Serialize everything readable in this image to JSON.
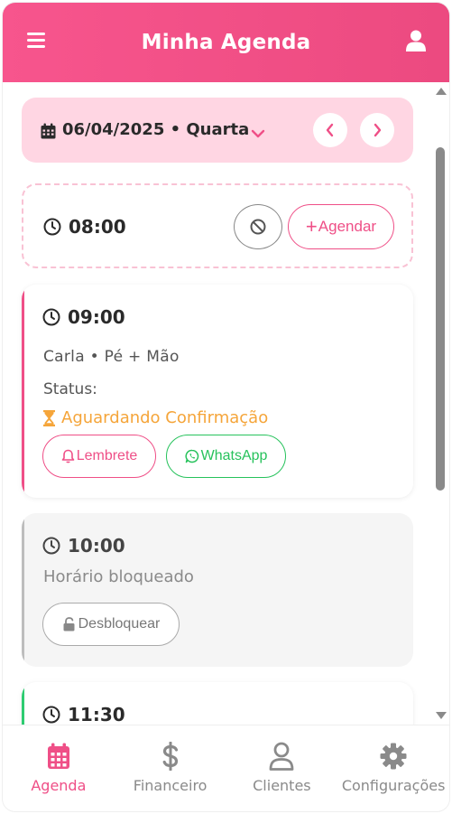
{
  "colors": {
    "primary": "#ef4f87",
    "header_gradient_start": "#f7558d",
    "date_bar_bg": "#ffd6e3",
    "pending": "#f5a53a",
    "whatsapp": "#27c25c",
    "blocked": "#bdbdbd",
    "available": "#2ecc71"
  },
  "header": {
    "title": "Minha Agenda",
    "menu_icon": "hamburger-menu-icon",
    "user_icon": "user-icon"
  },
  "date_bar": {
    "date": "06/04/2025",
    "weekday": "Quarta",
    "label": "06/04/2025 • Quarta"
  },
  "slots": [
    {
      "time": "08:00",
      "state": "free",
      "block_icon": "block-icon",
      "agendar_label": "Agendar"
    },
    {
      "time": "09:00",
      "state": "booked",
      "client_line": "Carla • Pé + Mão",
      "status_label": "Status:",
      "status_value": "Aguardando Confirmação",
      "reminder_label": "Lembrete",
      "whatsapp_label": "WhatsApp"
    },
    {
      "time": "10:00",
      "state": "blocked",
      "blocked_text": "Horário bloqueado",
      "unlock_label": "Desbloquear"
    },
    {
      "time": "11:30",
      "state": "partial"
    }
  ],
  "bottom_nav": [
    {
      "label": "Agenda",
      "icon": "calendar-icon",
      "active": true
    },
    {
      "label": "Financeiro",
      "icon": "dollar-icon",
      "active": false
    },
    {
      "label": "Clientes",
      "icon": "user-icon",
      "active": false
    },
    {
      "label": "Configurações",
      "icon": "gear-icon",
      "active": false
    }
  ]
}
